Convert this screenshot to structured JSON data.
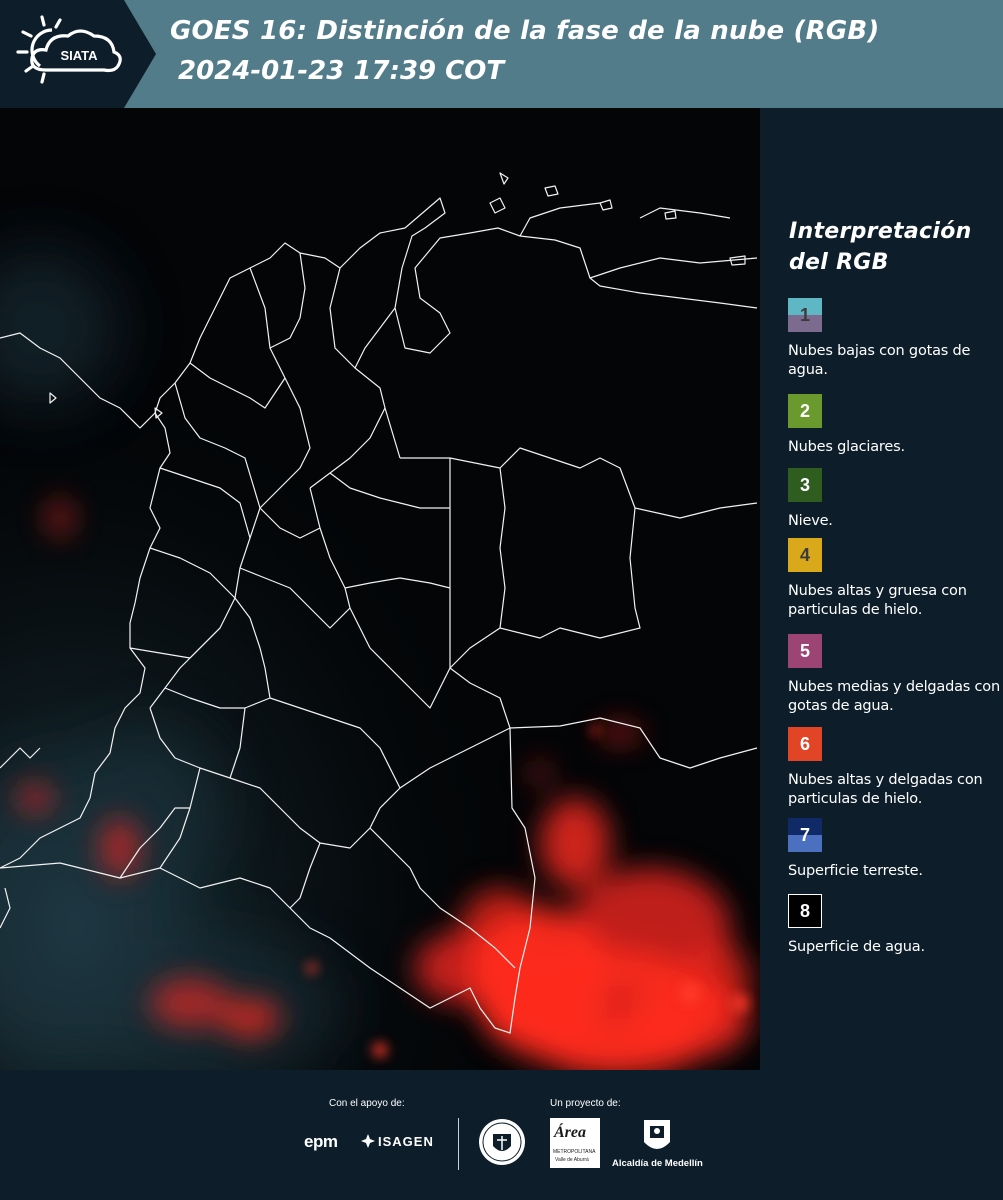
{
  "header": {
    "logo_text": "SIATA",
    "title_line1": "GOES 16: Distinción de la fase de la nube (RGB)",
    "title_line2": "2024-01-23 17:39 COT"
  },
  "legend": {
    "title": "Interpretación del RGB",
    "items": [
      {
        "number": "1",
        "label": "Nubes bajas con gotas de agua.",
        "color_top": "#5fb6c4",
        "color_bottom": "#7d6b8f",
        "number_color": "#3b3b3b"
      },
      {
        "number": "2",
        "label": "Nubes glaciares.",
        "color_top": "#6a9a2d",
        "color_bottom": "#6a9a2d",
        "number_color": "#ffffff"
      },
      {
        "number": "3",
        "label": "Nieve.",
        "color_top": "#2f5d1f",
        "color_bottom": "#2f5d1f",
        "number_color": "#ffffff"
      },
      {
        "number": "4",
        "label": "Nubes altas y gruesa con particulas de hielo.",
        "color_top": "#d9a91b",
        "color_bottom": "#d9a91b",
        "number_color": "#3b3b3b"
      },
      {
        "number": "5",
        "label": "Nubes medias y delgadas con gotas de agua.",
        "color_top": "#9c4474",
        "color_bottom": "#9c4474",
        "number_color": "#ffffff"
      },
      {
        "number": "6",
        "label": "Nubes altas y delgadas con particulas de hielo.",
        "color_top": "#e24526",
        "color_bottom": "#e24526",
        "number_color": "#ffffff"
      },
      {
        "number": "7",
        "label": "Superficie terreste.",
        "color_top": "#0f2a66",
        "color_bottom": "#4b70c0",
        "number_color": "#ffffff"
      },
      {
        "number": "8",
        "label": "Superficie de agua.",
        "color_top": "#000000",
        "color_bottom": "#000000",
        "number_color": "#ffffff"
      }
    ]
  },
  "footer": {
    "support_label": "Con el apoyo de:",
    "project_label": "Un proyecto de:",
    "sponsors": [
      "epm",
      "ISAGEN"
    ],
    "partners": [
      "Área Metropolitana Valle de Aburrá",
      "Alcaldía de Medellín"
    ],
    "area_logo_text": "Área",
    "area_logo_sub1": "METROPOLITANA",
    "area_logo_sub2": "Valle de Aburrá",
    "alcaldia_text": "Alcaldía de Medellín"
  }
}
